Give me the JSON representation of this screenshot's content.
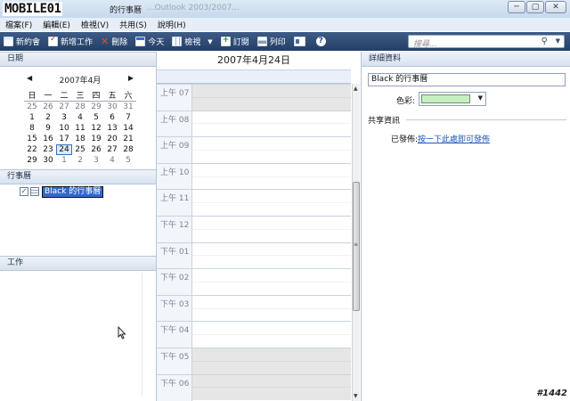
{
  "window": {
    "logo": "MOBILE01",
    "title": "的行事曆",
    "subtitle": "...Outlook 2003/2007...",
    "buttons": {
      "minimize": "─",
      "maximize": "▢",
      "close": "✕"
    }
  },
  "menu": [
    "檔案(F)",
    "編輯(E)",
    "檢視(V)",
    "共用(S)",
    "說明(H)"
  ],
  "toolbar": {
    "new_meeting": "新約會",
    "new_task": "新增工作",
    "delete": "刪除",
    "today": "今天",
    "view": "檢視",
    "view_drop": "▼",
    "subscribe": "訂閱",
    "print": "列印",
    "search_placeholder": "搜尋...",
    "search_icon": "⚲",
    "search_drop": "▼",
    "colors": {
      "bar_top": "#3d5b86",
      "bar_bottom": "#243f66"
    }
  },
  "left": {
    "date_header": "日期",
    "month_title": "2007年4月",
    "prev": "◀",
    "next": "▶",
    "weekdays": [
      "日",
      "一",
      "二",
      "三",
      "四",
      "五",
      "六"
    ],
    "weeks": [
      [
        {
          "d": "25",
          "o": true
        },
        {
          "d": "26",
          "o": true
        },
        {
          "d": "27",
          "o": true
        },
        {
          "d": "28",
          "o": true
        },
        {
          "d": "29",
          "o": true
        },
        {
          "d": "30",
          "o": true
        },
        {
          "d": "31",
          "o": true
        }
      ],
      [
        {
          "d": "1"
        },
        {
          "d": "2"
        },
        {
          "d": "3"
        },
        {
          "d": "4"
        },
        {
          "d": "5"
        },
        {
          "d": "6"
        },
        {
          "d": "7"
        }
      ],
      [
        {
          "d": "8"
        },
        {
          "d": "9"
        },
        {
          "d": "10"
        },
        {
          "d": "11"
        },
        {
          "d": "12"
        },
        {
          "d": "13"
        },
        {
          "d": "14"
        }
      ],
      [
        {
          "d": "15"
        },
        {
          "d": "16"
        },
        {
          "d": "17"
        },
        {
          "d": "18"
        },
        {
          "d": "19"
        },
        {
          "d": "20"
        },
        {
          "d": "21"
        }
      ],
      [
        {
          "d": "22"
        },
        {
          "d": "23"
        },
        {
          "d": "24",
          "sel": true
        },
        {
          "d": "25"
        },
        {
          "d": "26"
        },
        {
          "d": "27"
        },
        {
          "d": "28"
        }
      ],
      [
        {
          "d": "29"
        },
        {
          "d": "30"
        },
        {
          "d": "1",
          "o": true
        },
        {
          "d": "2",
          "o": true
        },
        {
          "d": "3",
          "o": true
        },
        {
          "d": "4",
          "o": true
        },
        {
          "d": "5",
          "o": true
        }
      ]
    ],
    "calendars_header": "行事曆",
    "calendar_item": "Black 的行事曆",
    "calendar_checked": "✓",
    "tasks_header": "工作"
  },
  "center": {
    "date": "2007年4月24日",
    "hours": [
      "上午 07",
      "上午 08",
      "上午 09",
      "上午 10",
      "上午 11",
      "下午 12",
      "下午 01",
      "下午 02",
      "下午 03",
      "下午 04",
      "下午 05",
      "下午 06"
    ],
    "working_hours": [
      "上午 08",
      "上午 09",
      "上午 10",
      "上午 11",
      "下午 12",
      "下午 01",
      "下午 02",
      "下午 03",
      "下午 04"
    ],
    "scroll": {
      "up": "▲",
      "down": "▼",
      "grip": "≡"
    }
  },
  "right": {
    "header": "詳細資料",
    "calendar_name": "Black 的行事曆",
    "color_label": "色彩:",
    "color_value": "#c6f0c2",
    "color_drop": "▼",
    "share_header": "共享資訊",
    "published_label": "已發佈:",
    "publish_link": "按一下此處即可發佈"
  },
  "watermark": "#1442"
}
